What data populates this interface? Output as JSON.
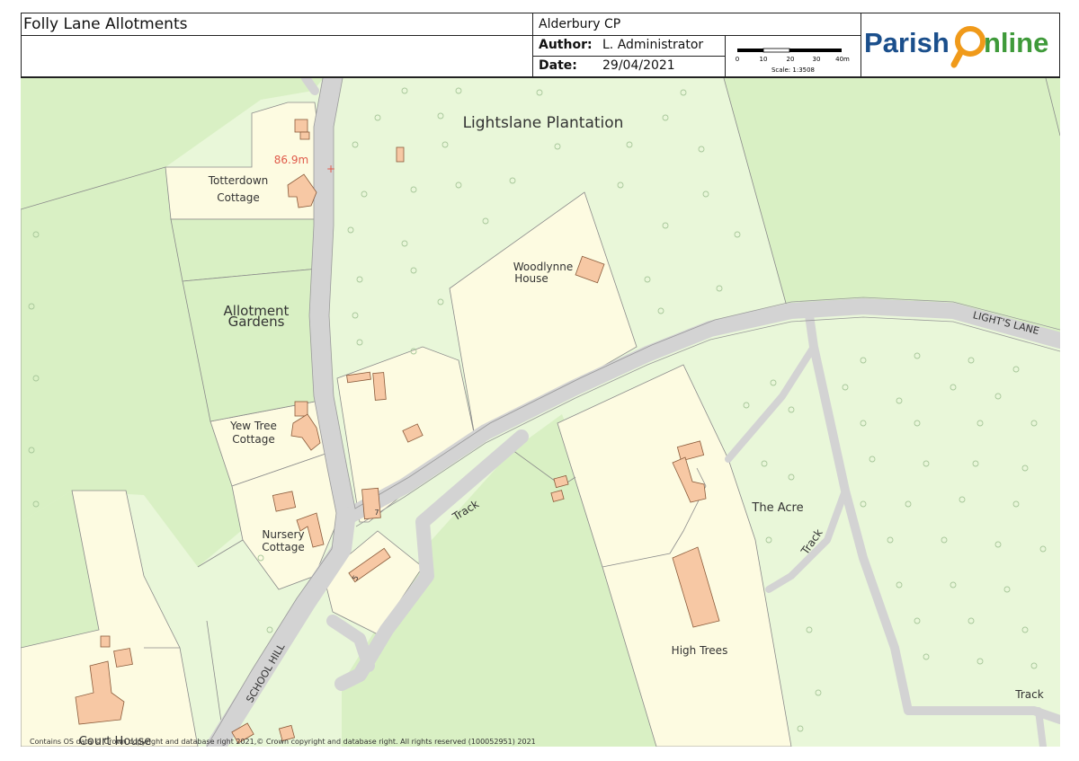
{
  "header": {
    "title": "Folly Lane Allotments",
    "parish": "Alderbury CP",
    "author_label": "Author:",
    "author_value": "L. Administrator",
    "date_label": "Date:",
    "date_value": "29/04/2021",
    "scale_ticks": [
      "0",
      "10",
      "20",
      "30",
      "40m"
    ],
    "scale_text": "Scale: 1:3508",
    "logo_part1": "Parish",
    "logo_part2": "nline"
  },
  "map": {
    "labels": {
      "plantation": "Lightslane Plantation",
      "spot_height": "86.9m",
      "totterdown_1": "Totterdown",
      "totterdown_2": "Cottage",
      "woodlynne_1": "Woodlynne",
      "woodlynne_2": "House",
      "allotment_1": "Allotment",
      "allotment_2": "Gardens",
      "lights_lane": "LIGHT'S LANE",
      "yew_1": "Yew Tree",
      "yew_2": "Cottage",
      "nursery_1": "Nursery",
      "nursery_2": "Cottage",
      "track_1": "Track",
      "track_2": "Track",
      "track_3": "Track",
      "the_acre": "The Acre",
      "high_trees": "High Trees",
      "school_hill": "SCHOOL HILL",
      "house_7": "7",
      "house_5": "5",
      "court_house": "Court House"
    },
    "copyright": "Contains OS data © Crown copyright and database right 2021,© Crown copyright and database right. All rights reserved (100052951) 2021"
  },
  "colors": {
    "woodland": "#e9f7d9",
    "field": "#d9f0c4",
    "garden": "#fdfbe1",
    "road": "#d6d6d6",
    "building": "#f7c8a4",
    "brand_blue": "#1b4f8c",
    "brand_green": "#3f9a3a",
    "brand_orange": "#f09a1a"
  }
}
